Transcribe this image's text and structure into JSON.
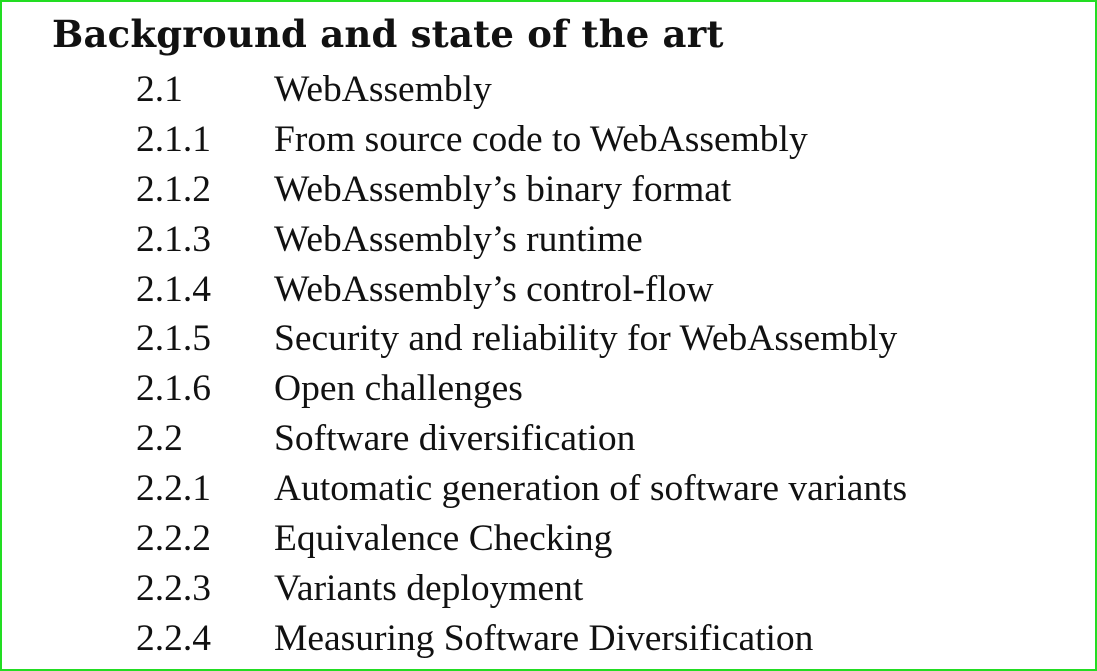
{
  "heading": "Background and state of the art",
  "entries": [
    {
      "number": "2.1",
      "title": "WebAssembly"
    },
    {
      "number": "2.1.1",
      "title": "From source code to WebAssembly"
    },
    {
      "number": "2.1.2",
      "title": "WebAssembly’s binary format"
    },
    {
      "number": "2.1.3",
      "title": "WebAssembly’s runtime"
    },
    {
      "number": "2.1.4",
      "title": "WebAssembly’s control-flow"
    },
    {
      "number": "2.1.5",
      "title": "Security and reliability for WebAssembly"
    },
    {
      "number": "2.1.6",
      "title": "Open challenges"
    },
    {
      "number": "2.2",
      "title": "Software diversification"
    },
    {
      "number": "2.2.1",
      "title": "Automatic generation of software variants"
    },
    {
      "number": "2.2.2",
      "title": "Equivalence Checking"
    },
    {
      "number": "2.2.3",
      "title": "Variants deployment"
    },
    {
      "number": "2.2.4",
      "title": "Measuring Software Diversification"
    }
  ],
  "colors": {
    "frame_border": "#22dd22",
    "text": "#111111",
    "background": "#ffffff"
  }
}
